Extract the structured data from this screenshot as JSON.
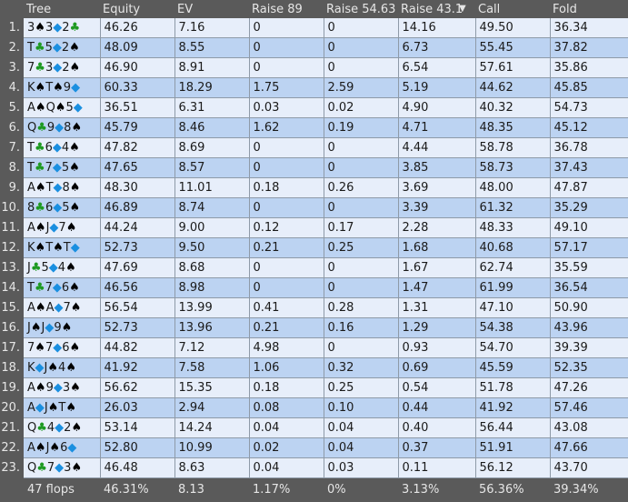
{
  "columns": [
    "Tree",
    "Equity",
    "EV",
    "Raise 89",
    "Raise 54.63",
    "Raise 43.1",
    "Call",
    "Fold"
  ],
  "sort_indicator": "▼",
  "rows": [
    {
      "idx": "1.",
      "tree": [
        {
          "r": "3",
          "s": "spade"
        },
        {
          "r": "3",
          "s": "diamond"
        },
        {
          "r": "2",
          "s": "club"
        }
      ],
      "equity": "46.26",
      "ev": "7.16",
      "raise89": "0",
      "raise5463": "0",
      "raise431": "14.16",
      "call": "49.50",
      "fold": "36.34"
    },
    {
      "idx": "2.",
      "tree": [
        {
          "r": "T",
          "s": "club"
        },
        {
          "r": "5",
          "s": "diamond"
        },
        {
          "r": "2",
          "s": "spade"
        }
      ],
      "equity": "48.09",
      "ev": "8.55",
      "raise89": "0",
      "raise5463": "0",
      "raise431": "6.73",
      "call": "55.45",
      "fold": "37.82"
    },
    {
      "idx": "3.",
      "tree": [
        {
          "r": "7",
          "s": "club"
        },
        {
          "r": "3",
          "s": "diamond"
        },
        {
          "r": "2",
          "s": "spade"
        }
      ],
      "equity": "46.90",
      "ev": "8.91",
      "raise89": "0",
      "raise5463": "0",
      "raise431": "6.54",
      "call": "57.61",
      "fold": "35.86"
    },
    {
      "idx": "4.",
      "tree": [
        {
          "r": "K",
          "s": "spade"
        },
        {
          "r": "T",
          "s": "spade"
        },
        {
          "r": "9",
          "s": "diamond"
        }
      ],
      "equity": "60.33",
      "ev": "18.29",
      "raise89": "1.75",
      "raise5463": "2.59",
      "raise431": "5.19",
      "call": "44.62",
      "fold": "45.85"
    },
    {
      "idx": "5.",
      "tree": [
        {
          "r": "A",
          "s": "spade"
        },
        {
          "r": "Q",
          "s": "spade"
        },
        {
          "r": "5",
          "s": "diamond"
        }
      ],
      "equity": "36.51",
      "ev": "6.31",
      "raise89": "0.03",
      "raise5463": "0.02",
      "raise431": "4.90",
      "call": "40.32",
      "fold": "54.73"
    },
    {
      "idx": "6.",
      "tree": [
        {
          "r": "Q",
          "s": "club"
        },
        {
          "r": "9",
          "s": "diamond"
        },
        {
          "r": "8",
          "s": "spade"
        }
      ],
      "equity": "45.79",
      "ev": "8.46",
      "raise89": "1.62",
      "raise5463": "0.19",
      "raise431": "4.71",
      "call": "48.35",
      "fold": "45.12"
    },
    {
      "idx": "7.",
      "tree": [
        {
          "r": "T",
          "s": "club"
        },
        {
          "r": "6",
          "s": "diamond"
        },
        {
          "r": "4",
          "s": "spade"
        }
      ],
      "equity": "47.82",
      "ev": "8.69",
      "raise89": "0",
      "raise5463": "0",
      "raise431": "4.44",
      "call": "58.78",
      "fold": "36.78"
    },
    {
      "idx": "8.",
      "tree": [
        {
          "r": "T",
          "s": "club"
        },
        {
          "r": "7",
          "s": "diamond"
        },
        {
          "r": "5",
          "s": "spade"
        }
      ],
      "equity": "47.65",
      "ev": "8.57",
      "raise89": "0",
      "raise5463": "0",
      "raise431": "3.85",
      "call": "58.73",
      "fold": "37.43"
    },
    {
      "idx": "9.",
      "tree": [
        {
          "r": "A",
          "s": "spade"
        },
        {
          "r": "T",
          "s": "diamond"
        },
        {
          "r": "8",
          "s": "spade"
        }
      ],
      "equity": "48.30",
      "ev": "11.01",
      "raise89": "0.18",
      "raise5463": "0.26",
      "raise431": "3.69",
      "call": "48.00",
      "fold": "47.87"
    },
    {
      "idx": "10.",
      "tree": [
        {
          "r": "8",
          "s": "club"
        },
        {
          "r": "6",
          "s": "diamond"
        },
        {
          "r": "5",
          "s": "spade"
        }
      ],
      "equity": "46.89",
      "ev": "8.74",
      "raise89": "0",
      "raise5463": "0",
      "raise431": "3.39",
      "call": "61.32",
      "fold": "35.29"
    },
    {
      "idx": "11.",
      "tree": [
        {
          "r": "A",
          "s": "spade"
        },
        {
          "r": "J",
          "s": "diamond"
        },
        {
          "r": "7",
          "s": "spade"
        }
      ],
      "equity": "44.24",
      "ev": "9.00",
      "raise89": "0.12",
      "raise5463": "0.17",
      "raise431": "2.28",
      "call": "48.33",
      "fold": "49.10"
    },
    {
      "idx": "12.",
      "tree": [
        {
          "r": "K",
          "s": "spade"
        },
        {
          "r": "T",
          "s": "spade"
        },
        {
          "r": "T",
          "s": "diamond"
        }
      ],
      "equity": "52.73",
      "ev": "9.50",
      "raise89": "0.21",
      "raise5463": "0.25",
      "raise431": "1.68",
      "call": "40.68",
      "fold": "57.17"
    },
    {
      "idx": "13.",
      "tree": [
        {
          "r": "J",
          "s": "club"
        },
        {
          "r": "5",
          "s": "diamond"
        },
        {
          "r": "4",
          "s": "spade"
        }
      ],
      "equity": "47.69",
      "ev": "8.68",
      "raise89": "0",
      "raise5463": "0",
      "raise431": "1.67",
      "call": "62.74",
      "fold": "35.59"
    },
    {
      "idx": "14.",
      "tree": [
        {
          "r": "T",
          "s": "club"
        },
        {
          "r": "7",
          "s": "diamond"
        },
        {
          "r": "6",
          "s": "spade"
        }
      ],
      "equity": "46.56",
      "ev": "8.98",
      "raise89": "0",
      "raise5463": "0",
      "raise431": "1.47",
      "call": "61.99",
      "fold": "36.54"
    },
    {
      "idx": "15.",
      "tree": [
        {
          "r": "A",
          "s": "spade"
        },
        {
          "r": "A",
          "s": "diamond"
        },
        {
          "r": "7",
          "s": "spade"
        }
      ],
      "equity": "56.54",
      "ev": "13.99",
      "raise89": "0.41",
      "raise5463": "0.28",
      "raise431": "1.31",
      "call": "47.10",
      "fold": "50.90"
    },
    {
      "idx": "16.",
      "tree": [
        {
          "r": "J",
          "s": "spade"
        },
        {
          "r": "J",
          "s": "diamond"
        },
        {
          "r": "9",
          "s": "spade"
        }
      ],
      "equity": "52.73",
      "ev": "13.96",
      "raise89": "0.21",
      "raise5463": "0.16",
      "raise431": "1.29",
      "call": "54.38",
      "fold": "43.96"
    },
    {
      "idx": "17.",
      "tree": [
        {
          "r": "7",
          "s": "spade"
        },
        {
          "r": "7",
          "s": "diamond"
        },
        {
          "r": "6",
          "s": "spade"
        }
      ],
      "equity": "44.82",
      "ev": "7.12",
      "raise89": "4.98",
      "raise5463": "0",
      "raise431": "0.93",
      "call": "54.70",
      "fold": "39.39"
    },
    {
      "idx": "18.",
      "tree": [
        {
          "r": "K",
          "s": "diamond"
        },
        {
          "r": "J",
          "s": "spade"
        },
        {
          "r": "4",
          "s": "spade"
        }
      ],
      "equity": "41.92",
      "ev": "7.58",
      "raise89": "1.06",
      "raise5463": "0.32",
      "raise431": "0.69",
      "call": "45.59",
      "fold": "52.35"
    },
    {
      "idx": "19.",
      "tree": [
        {
          "r": "A",
          "s": "spade"
        },
        {
          "r": "9",
          "s": "diamond"
        },
        {
          "r": "3",
          "s": "spade"
        }
      ],
      "equity": "56.62",
      "ev": "15.35",
      "raise89": "0.18",
      "raise5463": "0.25",
      "raise431": "0.54",
      "call": "51.78",
      "fold": "47.26"
    },
    {
      "idx": "20.",
      "tree": [
        {
          "r": "A",
          "s": "diamond"
        },
        {
          "r": "J",
          "s": "spade"
        },
        {
          "r": "T",
          "s": "spade"
        }
      ],
      "equity": "26.03",
      "ev": "2.94",
      "raise89": "0.08",
      "raise5463": "0.10",
      "raise431": "0.44",
      "call": "41.92",
      "fold": "57.46"
    },
    {
      "idx": "21.",
      "tree": [
        {
          "r": "Q",
          "s": "club"
        },
        {
          "r": "4",
          "s": "diamond"
        },
        {
          "r": "2",
          "s": "spade"
        }
      ],
      "equity": "53.14",
      "ev": "14.24",
      "raise89": "0.04",
      "raise5463": "0.04",
      "raise431": "0.40",
      "call": "56.44",
      "fold": "43.08"
    },
    {
      "idx": "22.",
      "tree": [
        {
          "r": "A",
          "s": "spade"
        },
        {
          "r": "J",
          "s": "spade"
        },
        {
          "r": "6",
          "s": "diamond"
        }
      ],
      "equity": "52.80",
      "ev": "10.99",
      "raise89": "0.02",
      "raise5463": "0.04",
      "raise431": "0.37",
      "call": "51.91",
      "fold": "47.66"
    },
    {
      "idx": "23.",
      "tree": [
        {
          "r": "Q",
          "s": "club"
        },
        {
          "r": "7",
          "s": "diamond"
        },
        {
          "r": "3",
          "s": "spade"
        }
      ],
      "equity": "46.48",
      "ev": "8.63",
      "raise89": "0.04",
      "raise5463": "0.03",
      "raise431": "0.11",
      "call": "56.12",
      "fold": "43.70"
    }
  ],
  "footer": {
    "tree": "47 flops",
    "equity": "46.31%",
    "ev": "8.13",
    "raise89": "1.17%",
    "raise5463": "0%",
    "raise431": "3.13%",
    "call": "56.36%",
    "fold": "39.34%"
  },
  "suit_glyphs": {
    "spade": "♠",
    "club": "♣",
    "diamond": "◆",
    "heart": "♥"
  },
  "colors": {
    "row_odd": "#e7eefa",
    "row_even": "#bcd3f2",
    "header_bg": "#5a5a5a",
    "spade": "#000000",
    "club": "#1e9a22",
    "diamond": "#1a8fe0"
  }
}
